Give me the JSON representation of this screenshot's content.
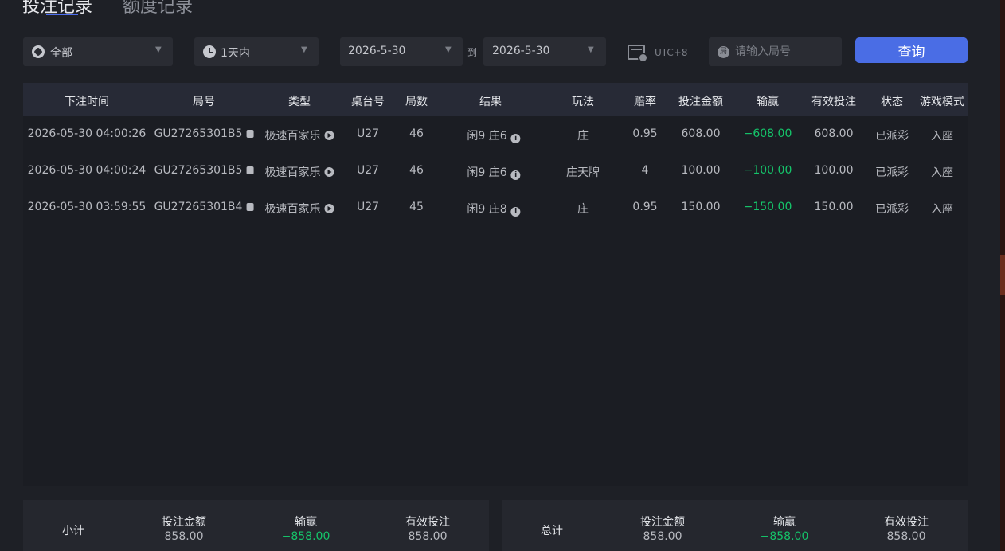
{
  "tabs": {
    "active": "投注记录",
    "inactive": "额度记录"
  },
  "filters": {
    "game_type": "全部",
    "time_range": "1天内",
    "date_from": "2026-5-30",
    "to_label": "到",
    "date_to": "2026-5-30",
    "timezone": "UTC+8",
    "search_icon_text": "局",
    "search_placeholder": "请输入局号",
    "query_label": "查询"
  },
  "table": {
    "headers": [
      "下注时间",
      "局号",
      "类型",
      "桌台号",
      "局数",
      "结果",
      "玩法",
      "赔率",
      "投注金额",
      "输赢",
      "有效投注",
      "状态",
      "游戏模式"
    ],
    "rows": [
      {
        "time": "2026-05-30 04:00:26",
        "round": "GU27265301B5",
        "type": "极速百家乐",
        "table": "U27",
        "count": "46",
        "result": "闲9 庄6",
        "play": "庄",
        "odds": "0.95",
        "bet": "608.00",
        "win": "−608.00",
        "valid": "608.00",
        "status": "已派彩",
        "mode": "入座"
      },
      {
        "time": "2026-05-30 04:00:24",
        "round": "GU27265301B5",
        "type": "极速百家乐",
        "table": "U27",
        "count": "46",
        "result": "闲9 庄6",
        "play": "庄天牌",
        "odds": "4",
        "bet": "100.00",
        "win": "−100.00",
        "valid": "100.00",
        "status": "已派彩",
        "mode": "入座"
      },
      {
        "time": "2026-05-30 03:59:55",
        "round": "GU27265301B4",
        "type": "极速百家乐",
        "table": "U27",
        "count": "45",
        "result": "闲9 庄8",
        "play": "庄",
        "odds": "0.95",
        "bet": "150.00",
        "win": "−150.00",
        "valid": "150.00",
        "status": "已派彩",
        "mode": "入座"
      }
    ]
  },
  "subtotal": {
    "label": "小计",
    "bet_label": "投注金额",
    "bet": "858.00",
    "win_label": "输赢",
    "win": "−858.00",
    "valid_label": "有效投注",
    "valid": "858.00"
  },
  "total": {
    "label": "总计",
    "bet_label": "投注金额",
    "bet": "858.00",
    "win_label": "输赢",
    "win": "−858.00",
    "valid_label": "有效投注",
    "valid": "858.00"
  },
  "colors": {
    "accent": "#4a6de5",
    "negative": "#15c46a",
    "background": "#1e2026"
  }
}
